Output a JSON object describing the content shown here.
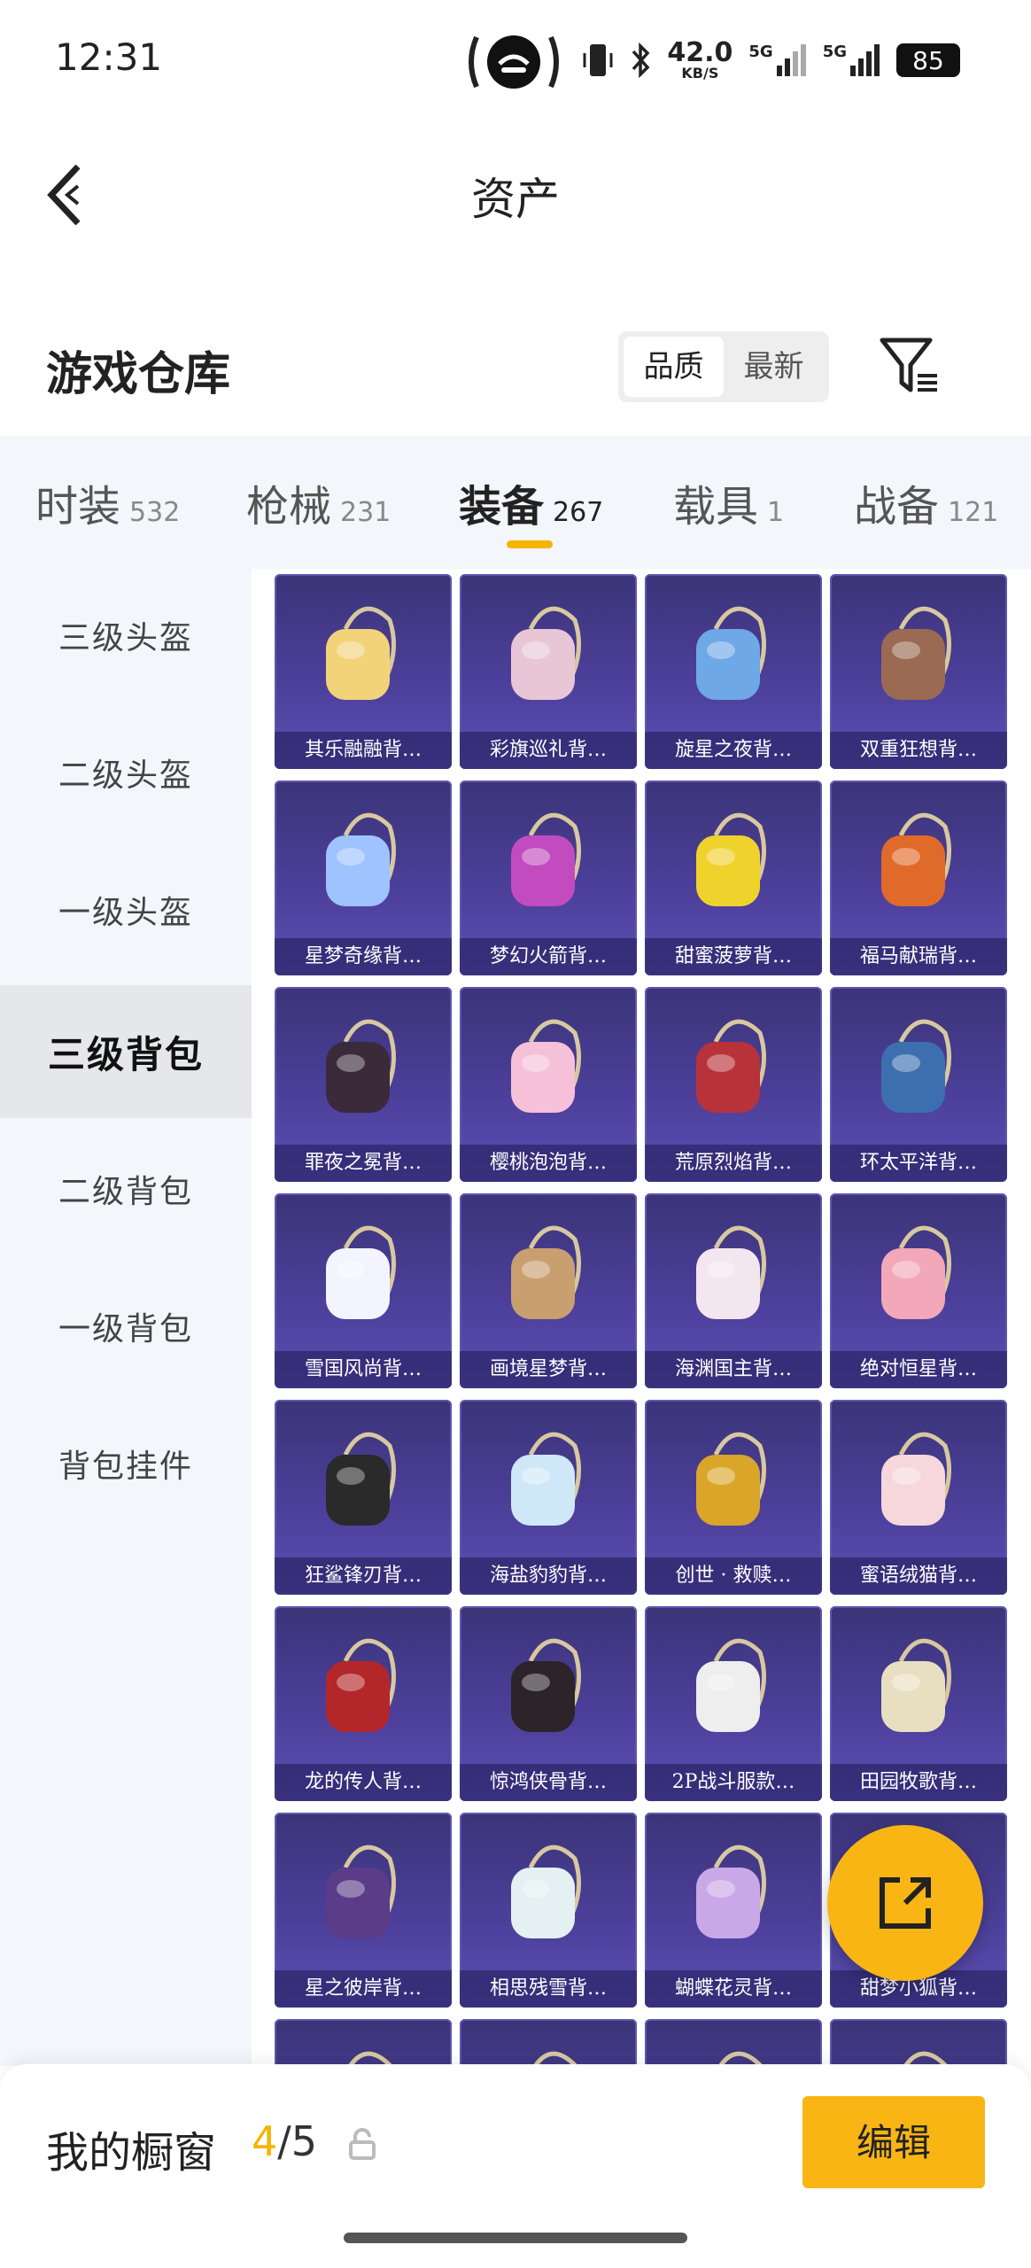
{
  "status_bar": {
    "time": "12:31",
    "speed_value": "42.0",
    "speed_unit": "KB/S",
    "net1": "5G",
    "net2": "5G",
    "battery": "85"
  },
  "header": {
    "title": "资产"
  },
  "warehouse": {
    "title": "游戏仓库",
    "sort_options": [
      "品质",
      "最新"
    ],
    "active_sort": "品质"
  },
  "tabs": [
    {
      "label": "时装",
      "count": "532"
    },
    {
      "label": "枪械",
      "count": "231"
    },
    {
      "label": "装备",
      "count": "267"
    },
    {
      "label": "载具",
      "count": "1"
    },
    {
      "label": "战备",
      "count": "121"
    }
  ],
  "active_tab": "装备",
  "sidebar": {
    "items": [
      "三级头盔",
      "二级头盔",
      "一级头盔",
      "三级背包",
      "二级背包",
      "一级背包",
      "背包挂件"
    ],
    "active": "三级背包"
  },
  "grid_items": [
    {
      "name": "其乐融融背…",
      "color": "#f2d37a"
    },
    {
      "name": "彩旗巡礼背…",
      "color": "#e9c6d6"
    },
    {
      "name": "旋星之夜背…",
      "color": "#6fa8e6"
    },
    {
      "name": "双重狂想背…",
      "color": "#9a6a52"
    },
    {
      "name": "星梦奇缘背…",
      "color": "#9fc3ff"
    },
    {
      "name": "梦幻火箭背…",
      "color": "#c24bbf"
    },
    {
      "name": "甜蜜菠萝背…",
      "color": "#f0d22c"
    },
    {
      "name": "福马献瑞背…",
      "color": "#e06a2a"
    },
    {
      "name": "罪夜之冕背…",
      "color": "#3a2a3a"
    },
    {
      "name": "樱桃泡泡背…",
      "color": "#f6c0d8"
    },
    {
      "name": "荒原烈焰背…",
      "color": "#b8323a"
    },
    {
      "name": "环太平洋背…",
      "color": "#3d6fb0"
    },
    {
      "name": "雪国风尚背…",
      "color": "#f4f4ff"
    },
    {
      "name": "画境星梦背…",
      "color": "#c8a070"
    },
    {
      "name": "海渊国主背…",
      "color": "#f3e6ef"
    },
    {
      "name": "绝对恒星背…",
      "color": "#f2a8b8"
    },
    {
      "name": "狂鲨锋刃背…",
      "color": "#2a2a2a"
    },
    {
      "name": "海盐豹豹背…",
      "color": "#cfe8f8"
    },
    {
      "name": "创世 · 救赎…",
      "color": "#d9a62a"
    },
    {
      "name": "蜜语绒猫背…",
      "color": "#f6d8dc"
    },
    {
      "name": "龙的传人背…",
      "color": "#b3262a"
    },
    {
      "name": "惊鸿侠骨背…",
      "color": "#2c2428"
    },
    {
      "name": "2P战斗服款…",
      "color": "#eeeeee"
    },
    {
      "name": "田园牧歌背…",
      "color": "#e8dfc0"
    },
    {
      "name": "星之彼岸背…",
      "color": "#5a3c88"
    },
    {
      "name": "相思残雪背…",
      "color": "#e4f0f2"
    },
    {
      "name": "蝴蝶花灵背…",
      "color": "#c9a8e8"
    },
    {
      "name": "甜梦小狐背…",
      "color": "#f0b080"
    },
    {
      "name": "",
      "color": "#4a4a6a"
    },
    {
      "name": "",
      "color": "#d0a2c8"
    },
    {
      "name": "",
      "color": "#c75aa8"
    },
    {
      "name": "",
      "color": "#6a8a6a"
    }
  ],
  "showcase": {
    "label": "我的橱窗",
    "current": "4",
    "separator": "/",
    "total": "5",
    "edit_label": "编辑"
  },
  "colors": {
    "accent": "#f8b514",
    "card_bg": "#4c3f9a"
  }
}
